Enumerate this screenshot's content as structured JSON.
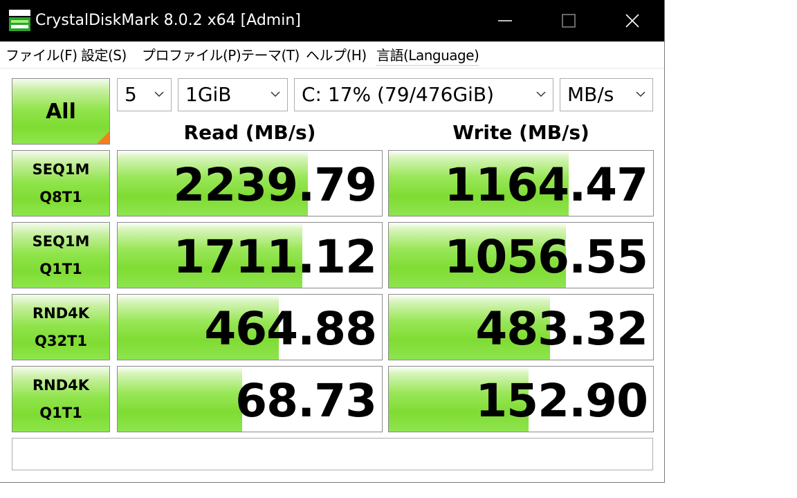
{
  "window": {
    "title": "CrystalDiskMark 8.0.2 x64 [Admin]"
  },
  "menu": [
    "ファイル(F)",
    "設定(S)",
    "プロファイル(P)",
    "テーマ(T)",
    "ヘルプ(H)",
    "言語(Language)"
  ],
  "controls": {
    "all_label": "All",
    "count": "5",
    "size": "1GiB",
    "drive": "C: 17% (79/476GiB)",
    "unit": "MB/s"
  },
  "headers": {
    "read": "Read (MB/s)",
    "write": "Write (MB/s)"
  },
  "tests": [
    {
      "line1": "SEQ1M",
      "line2": "Q8T1",
      "read": "2239.79",
      "read_fill": 0.72,
      "write": "1164.47",
      "write_fill": 0.68
    },
    {
      "line1": "SEQ1M",
      "line2": "Q1T1",
      "read": "1711.12",
      "read_fill": 0.7,
      "write": "1056.55",
      "write_fill": 0.67
    },
    {
      "line1": "RND4K",
      "line2": "Q32T1",
      "read": "464.88",
      "read_fill": 0.61,
      "write": "483.32",
      "write_fill": 0.61
    },
    {
      "line1": "RND4K",
      "line2": "Q1T1",
      "read": "68.73",
      "read_fill": 0.47,
      "write": "152.90",
      "write_fill": 0.53
    }
  ],
  "comment": "",
  "colors": {
    "accent_green": "#7fdc33",
    "corner_orange": "#f08020",
    "titlebar": "#000000"
  },
  "icons": {
    "app": "drive-icon",
    "minimize": "minimize-icon",
    "maximize": "maximize-icon",
    "close": "close-icon",
    "dropdown": "chevron-down-icon"
  }
}
